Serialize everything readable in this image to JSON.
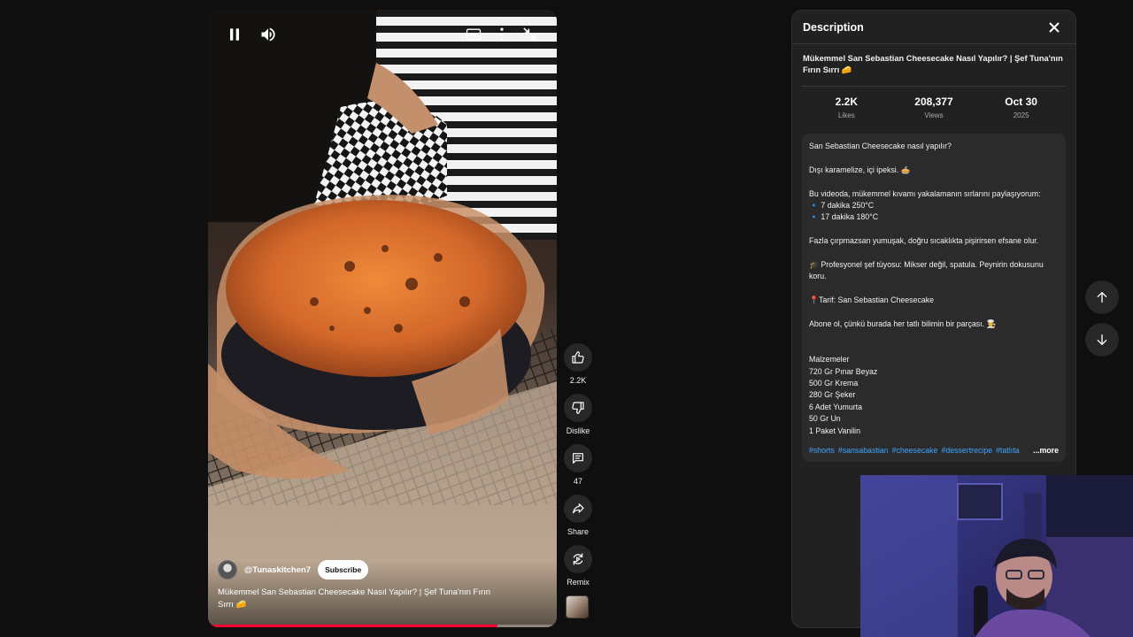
{
  "player": {
    "icons": [
      "pause-icon",
      "volume-icon",
      "captions-icon",
      "more-vert-icon",
      "exit-fullscreen-icon"
    ],
    "channel_name": "@Tunaskitchen7",
    "subscribe_label": "Subscribe",
    "video_title": "Mükemmel San Sebastian Cheesecake Nasıl Yapılır? | Şef Tuna'nın Fırın Sırrı 🧀",
    "progress_fraction": 0.83
  },
  "actions": {
    "like_count": "2.2K",
    "dislike_label": "Dislike",
    "comment_count": "47",
    "share_label": "Share",
    "remix_label": "Remix"
  },
  "description": {
    "header_title": "Description",
    "video_title": "Mükemmel San Sebastian Cheesecake Nasıl Yapılır? | Şef Tuna'nın Fırın Sırrı 🧀",
    "stats": [
      {
        "value": "2.2K",
        "label": "Likes"
      },
      {
        "value": "208,377",
        "label": "Views"
      },
      {
        "value": "Oct 30",
        "label": "2025"
      }
    ],
    "lines": [
      "San Sebastian Cheesecake nasıl yapılır?",
      "",
      "Dışı karamelize, içi ipeksi. 🥧",
      "",
      "Bu videoda, mükemmel kıvamı yakalamanın sırlarını paylaşıyorum:",
      "🔹 7 dakika 250°C",
      "🔹 17 dakika 180°C",
      "",
      "Fazla çırpmazsan yumuşak, doğru sıcaklıkta pişirirsen efsane olur.",
      "",
      "🎓 Profesyonel şef tüyosu: Mikser değil, spatula. Peynirin dokusunu koru.",
      "",
      "📍Tarif: San Sebastian Cheesecake",
      "",
      "Abone ol, çünkü burada her tatlı bilimin bir parçası. 👨‍🍳",
      "",
      "",
      "Malzemeler",
      "720 Gr Pınar Beyaz",
      "500 Gr Krema",
      "280 Gr Şeker",
      "6 Adet Yumurta",
      "50 Gr Un",
      "1 Paket Vanilin"
    ],
    "hashtags": [
      "#shorts",
      "#sansabastian",
      "#cheesecake",
      "#dessertrecipe",
      "#tatlıta"
    ],
    "more_label": "...more"
  },
  "nav": {
    "up_icon": "arrow-up-icon",
    "down_icon": "arrow-down-icon"
  },
  "colors": {
    "background": "#0f0f0f",
    "panel": "#212121",
    "link": "#3ea6ff",
    "progress": "#ff0033"
  }
}
